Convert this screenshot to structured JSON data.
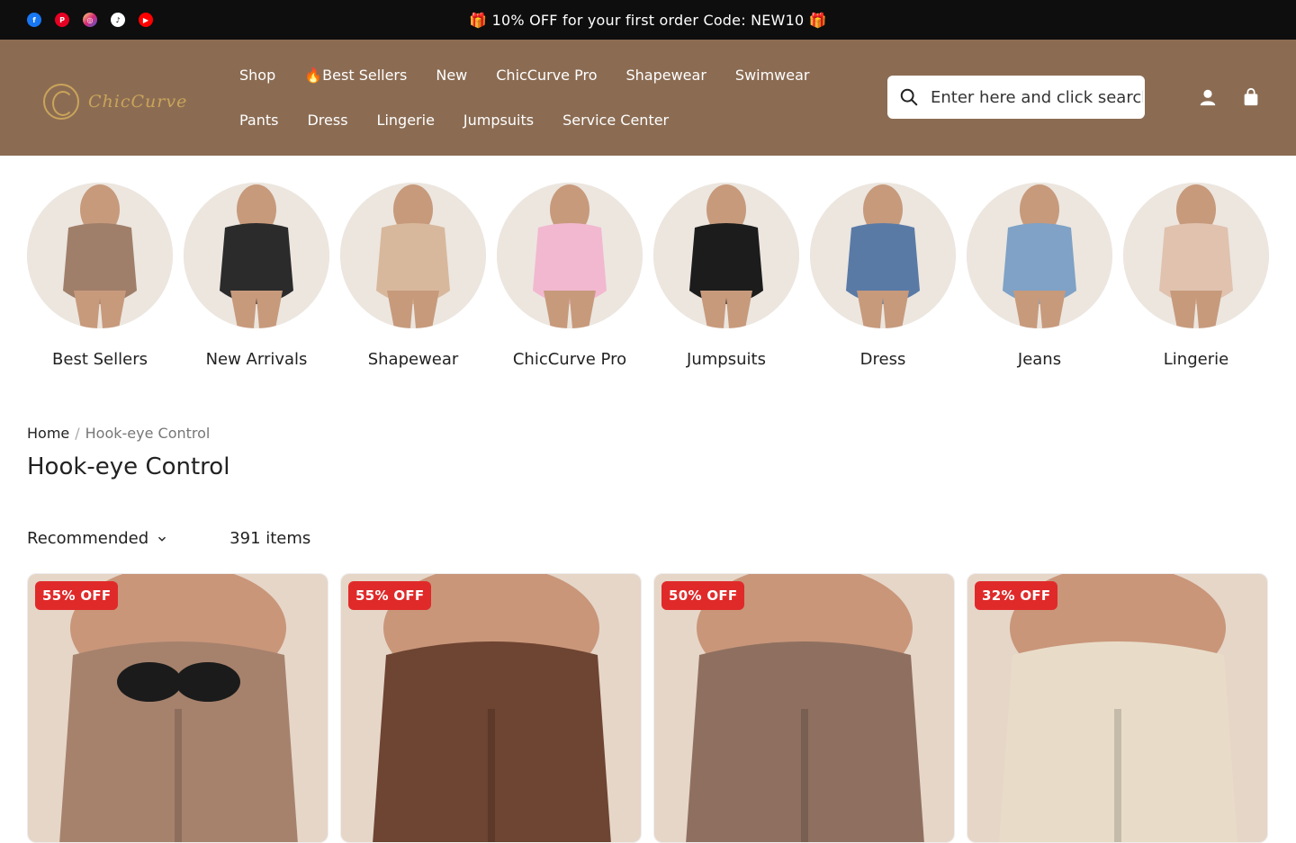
{
  "announcement": "🎁 10% OFF for your first order Code: NEW10 🎁",
  "socials": [
    {
      "name": "facebook-icon",
      "glyph": "f"
    },
    {
      "name": "pinterest-icon",
      "glyph": "P"
    },
    {
      "name": "instagram-icon",
      "glyph": "◎"
    },
    {
      "name": "tiktok-icon",
      "glyph": "♪"
    },
    {
      "name": "youtube-icon",
      "glyph": "▶"
    }
  ],
  "logo_text": "ChicCurve",
  "nav": {
    "row1": [
      "Shop",
      "🔥Best Sellers",
      "New",
      "ChicCurve Pro",
      "Shapewear",
      "Swimwear"
    ],
    "row2": [
      "Pants",
      "Dress",
      "Lingerie",
      "Jumpsuits",
      "Service Center"
    ]
  },
  "search": {
    "placeholder": "Enter here and click search"
  },
  "categories": [
    {
      "label": "Best Sellers",
      "color": "#a07f6a"
    },
    {
      "label": "New Arrivals",
      "color": "#2b2b2b"
    },
    {
      "label": "Shapewear",
      "color": "#d8b89c"
    },
    {
      "label": "ChicCurve Pro",
      "color": "#f2b8d0"
    },
    {
      "label": "Jumpsuits",
      "color": "#1c1c1c"
    },
    {
      "label": "Dress",
      "color": "#5a7aa6"
    },
    {
      "label": "Jeans",
      "color": "#7fa2c6"
    },
    {
      "label": "Lingerie",
      "color": "#e0c2ae"
    }
  ],
  "breadcrumb": {
    "home": "Home",
    "separator": "/",
    "current": "Hook-eye Control"
  },
  "page_title": "Hook-eye Control",
  "sort_label": "Recommended",
  "item_count": "391 items",
  "products": [
    {
      "badge": "55% OFF",
      "color": "#a6826d"
    },
    {
      "badge": "55% OFF",
      "color": "#6e4432"
    },
    {
      "badge": "50% OFF",
      "color": "#8f7060"
    },
    {
      "badge": "32% OFF",
      "color": "#e8dcc8"
    }
  ]
}
